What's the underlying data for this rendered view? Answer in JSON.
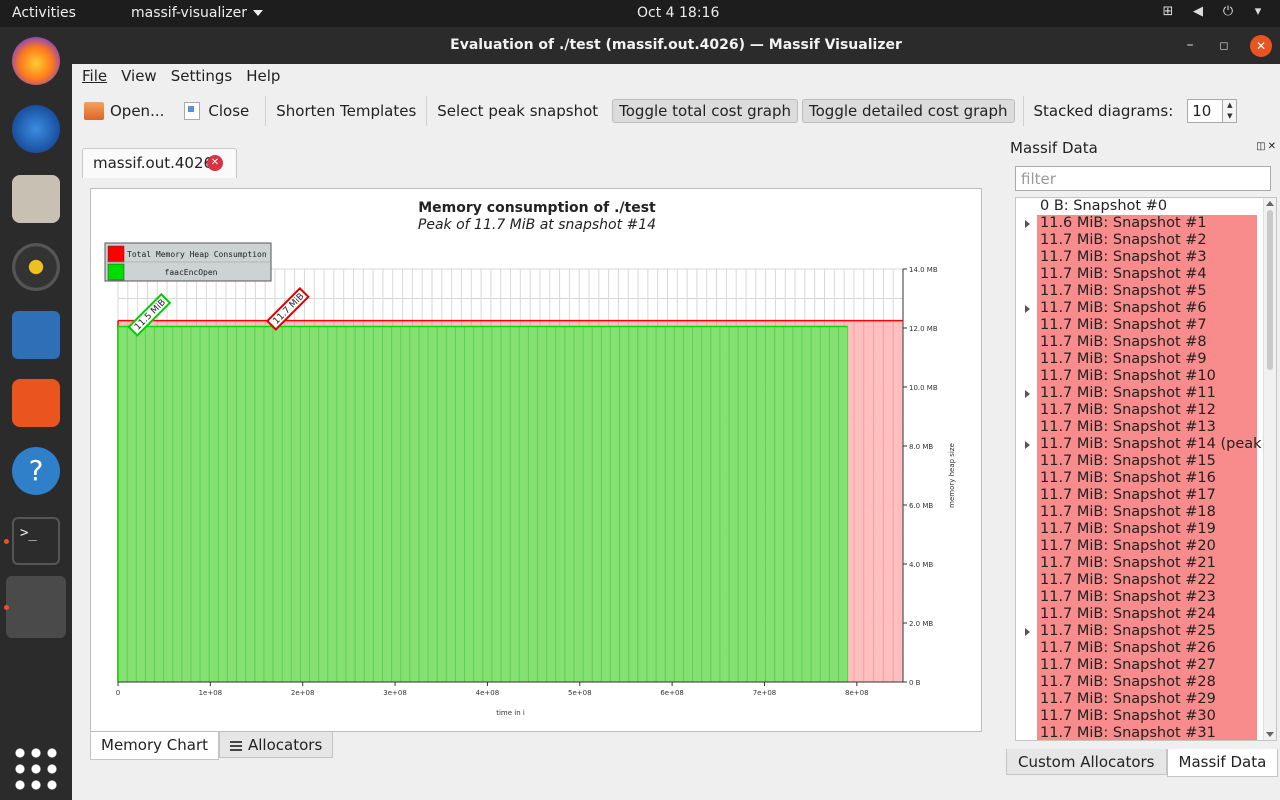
{
  "topbar": {
    "activities": "Activities",
    "app_name": "massif-visualizer",
    "clock": "Oct 4  18:16"
  },
  "window": {
    "title": "Evaluation of ./test (massif.out.4026) — Massif Visualizer"
  },
  "menu": {
    "file": "File",
    "view": "View",
    "settings": "Settings",
    "help": "Help"
  },
  "toolbar": {
    "open": "Open...",
    "close": "Close",
    "shorten": "Shorten Templates",
    "select_peak": "Select peak snapshot",
    "toggle_total": "Toggle total cost graph",
    "toggle_detailed": "Toggle detailed cost graph",
    "stacked_label": "Stacked diagrams:",
    "stacked_value": "10"
  },
  "doc_tab": {
    "label": "massif.out.4026"
  },
  "chart_data": {
    "type": "area",
    "title": "Memory consumption of ./test",
    "subtitle": "Peak of 11.7 MiB at snapshot #14",
    "xlabel": "time in i",
    "ylabel": "memory heap size",
    "xlim": [
      0,
      850000000
    ],
    "ylim": [
      0,
      14
    ],
    "x_ticks": [
      "0",
      "1e+08",
      "2e+08",
      "3e+08",
      "4e+08",
      "5e+08",
      "6e+08",
      "7e+08",
      "8e+08"
    ],
    "y_ticks": [
      "0 B",
      "2.0 MB",
      "4.0 MB",
      "6.0 MB",
      "8.0 MB",
      "10.0 MB",
      "12.0 MB",
      "14.0 MB"
    ],
    "legend_position": "top-left",
    "series": [
      {
        "name": "Total Memory Heap Consumption",
        "color": "#ff0000",
        "fill": "#ffbcbc",
        "x": [
          0,
          850000000
        ],
        "values": [
          12.25,
          12.25
        ]
      },
      {
        "name": "faacEncOpen",
        "color": "#00dd00",
        "fill": "#7ee36e",
        "x": [
          0,
          790000000
        ],
        "values": [
          12.05,
          12.05
        ]
      }
    ],
    "annotations": [
      {
        "text": "11.5 MiB",
        "x": 20000000,
        "color": "#00cc00"
      },
      {
        "text": "11.7 MiB",
        "x": 170000000,
        "color": "#e00000"
      }
    ],
    "grid": true
  },
  "bottom_tabs": {
    "memory_chart": "Memory Chart",
    "allocators": "Allocators"
  },
  "side": {
    "title": "Massif Data",
    "filter_placeholder": "filter",
    "snapshots": [
      {
        "label": "0 B: Snapshot #0",
        "hl": false,
        "exp": false
      },
      {
        "label": "11.6 MiB: Snapshot #1",
        "hl": true,
        "exp": true
      },
      {
        "label": "11.7 MiB: Snapshot #2",
        "hl": true,
        "exp": false
      },
      {
        "label": "11.7 MiB: Snapshot #3",
        "hl": true,
        "exp": false
      },
      {
        "label": "11.7 MiB: Snapshot #4",
        "hl": true,
        "exp": false
      },
      {
        "label": "11.7 MiB: Snapshot #5",
        "hl": true,
        "exp": false
      },
      {
        "label": "11.7 MiB: Snapshot #6",
        "hl": true,
        "exp": true
      },
      {
        "label": "11.7 MiB: Snapshot #7",
        "hl": true,
        "exp": false
      },
      {
        "label": "11.7 MiB: Snapshot #8",
        "hl": true,
        "exp": false
      },
      {
        "label": "11.7 MiB: Snapshot #9",
        "hl": true,
        "exp": false
      },
      {
        "label": "11.7 MiB: Snapshot #10",
        "hl": true,
        "exp": false
      },
      {
        "label": "11.7 MiB: Snapshot #11",
        "hl": true,
        "exp": true
      },
      {
        "label": "11.7 MiB: Snapshot #12",
        "hl": true,
        "exp": false
      },
      {
        "label": "11.7 MiB: Snapshot #13",
        "hl": true,
        "exp": false
      },
      {
        "label": "11.7 MiB: Snapshot #14 (peak)",
        "hl": true,
        "exp": true
      },
      {
        "label": "11.7 MiB: Snapshot #15",
        "hl": true,
        "exp": false
      },
      {
        "label": "11.7 MiB: Snapshot #16",
        "hl": true,
        "exp": false
      },
      {
        "label": "11.7 MiB: Snapshot #17",
        "hl": true,
        "exp": false
      },
      {
        "label": "11.7 MiB: Snapshot #18",
        "hl": true,
        "exp": false
      },
      {
        "label": "11.7 MiB: Snapshot #19",
        "hl": true,
        "exp": false
      },
      {
        "label": "11.7 MiB: Snapshot #20",
        "hl": true,
        "exp": false
      },
      {
        "label": "11.7 MiB: Snapshot #21",
        "hl": true,
        "exp": false
      },
      {
        "label": "11.7 MiB: Snapshot #22",
        "hl": true,
        "exp": false
      },
      {
        "label": "11.7 MiB: Snapshot #23",
        "hl": true,
        "exp": false
      },
      {
        "label": "11.7 MiB: Snapshot #24",
        "hl": true,
        "exp": false
      },
      {
        "label": "11.7 MiB: Snapshot #25",
        "hl": true,
        "exp": true
      },
      {
        "label": "11.7 MiB: Snapshot #26",
        "hl": true,
        "exp": false
      },
      {
        "label": "11.7 MiB: Snapshot #27",
        "hl": true,
        "exp": false
      },
      {
        "label": "11.7 MiB: Snapshot #28",
        "hl": true,
        "exp": false
      },
      {
        "label": "11.7 MiB: Snapshot #29",
        "hl": true,
        "exp": false
      },
      {
        "label": "11.7 MiB: Snapshot #30",
        "hl": true,
        "exp": false
      },
      {
        "label": "11.7 MiB: Snapshot #31",
        "hl": true,
        "exp": false
      }
    ]
  },
  "side_tabs": {
    "custom": "Custom Allocators",
    "massif": "Massif Data"
  }
}
